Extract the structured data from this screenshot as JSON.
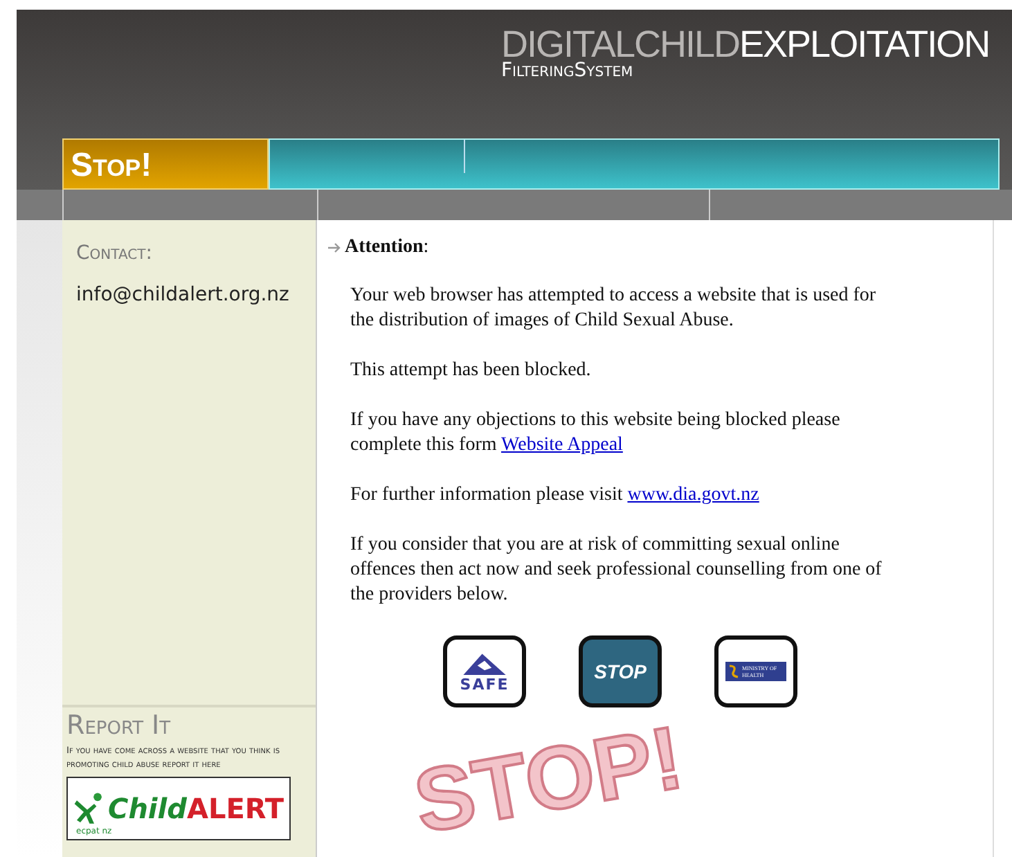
{
  "header": {
    "title_light": "DIGITALCHILD",
    "title_bold": "EXPLOITATION",
    "subtitle": "FilteringSystem"
  },
  "banner": {
    "label": "Stop!"
  },
  "sidebar": {
    "contact_heading": "Contact:",
    "email": "info@childalert.org.nz",
    "report_heading": "Report It",
    "report_text": "If you have come across a website that you think is promoting child abuse report it here",
    "logo": {
      "word_1": "Child",
      "word_2": "ALERT",
      "tagline": "ecpat nz"
    }
  },
  "main": {
    "heading": "**Attention**:",
    "paragraphs": [
      {
        "text": "Your web browser has attempted to access a website that is used for the distribution of images of Child Sexual Abuse."
      },
      {
        "text": "This attempt has been blocked."
      },
      {
        "text": "If you have any objections to this website being blocked please complete this form",
        "link": "Website Appeal"
      },
      {
        "text": "For further information please visit",
        "link": "www.dia.govt.nz"
      },
      {
        "text": "If you consider that you are at risk of committing sexual online offences then act now and seek professional counselling from one of the providers below."
      }
    ],
    "providers": [
      {
        "kind": "safe",
        "label": "SAFE"
      },
      {
        "kind": "stop",
        "label": "STOP"
      },
      {
        "kind": "health",
        "label": "MINISTRY OF HEALTH"
      }
    ],
    "stamp": "STOP!"
  }
}
